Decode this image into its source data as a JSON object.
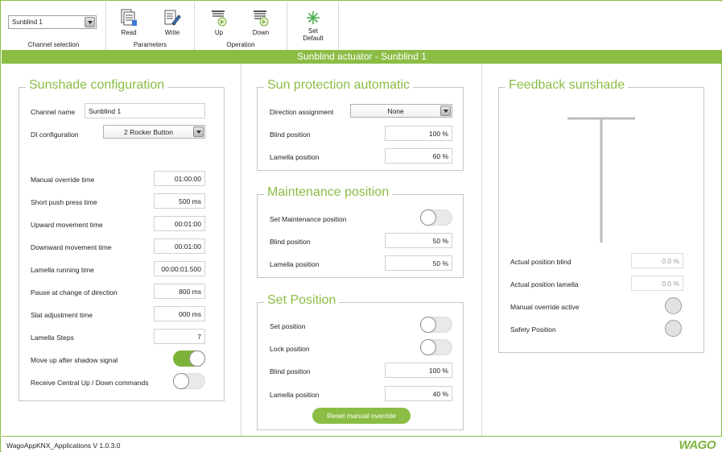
{
  "toolbar": {
    "channel_value": "Sunblind 1",
    "channel_group_label": "Channel selection",
    "read_label": "Read",
    "write_label": "Write",
    "parameters_group_label": "Parameters",
    "up_label": "Up",
    "down_label": "Down",
    "operation_group_label": "Operation",
    "set_default_label_1": "Set",
    "set_default_label_2": "Default"
  },
  "title": "Sunblind actuator - Sunblind 1",
  "sunshade": {
    "legend": "Sunshade configuration",
    "channel_name_label": "Channel name",
    "channel_name_value": "Sunblind 1",
    "di_label": "DI configuration",
    "di_value": "2 Rocker Button",
    "rows": [
      {
        "label": "Manual override time",
        "value": "01:00:00"
      },
      {
        "label": "Short push press time",
        "value": "500 ms"
      },
      {
        "label": "Upward movement time",
        "value": "00:01:00"
      },
      {
        "label": "Downward movement time",
        "value": "00:01:00"
      },
      {
        "label": "Lamella running time",
        "value": "00:00:01.500"
      },
      {
        "label": "Pause at change of direction",
        "value": "800 ms"
      },
      {
        "label": "Slat adjustment time",
        "value": "000 ms"
      },
      {
        "label": "Lamella Steps",
        "value": "7"
      }
    ],
    "move_up_label": "Move up after shadow signal",
    "move_up_on": true,
    "central_label": "Receive Central Up / Down commands",
    "central_on": false
  },
  "sun_protection": {
    "legend": "Sun protection automatic",
    "direction_label": "Direction assignment",
    "direction_value": "None",
    "blind_label": "Blind position",
    "blind_value": "100 %",
    "lamella_label": "Lamella position",
    "lamella_value": "60 %"
  },
  "maintenance": {
    "legend": "Maintenance position",
    "set_label": "Set Maintenance position",
    "set_on": false,
    "blind_label": "Blind position",
    "blind_value": "50 %",
    "lamella_label": "Lamella position",
    "lamella_value": "50 %"
  },
  "set_position": {
    "legend": "Set Position",
    "set_label": "Set position",
    "set_on": false,
    "lock_label": "Lock position",
    "lock_on": false,
    "blind_label": "Blind position",
    "blind_value": "100 %",
    "lamella_label": "Lamella position",
    "lamella_value": "40 %",
    "reset_label": "Reset manual override"
  },
  "feedback": {
    "legend": "Feedback sunshade",
    "actual_blind_label": "Actual position blind",
    "actual_blind_value": "0.0 %",
    "actual_lamella_label": "Actual position lamella",
    "actual_lamella_value": "0.0 %",
    "manual_override_label": "Manual override active",
    "safety_label": "Safety Position"
  },
  "status": {
    "app_version": "WagoAppKNX_Applications V 1.0.3.0",
    "logo": "WAGO"
  },
  "colors": {
    "accent": "#8bbd45",
    "toggle_on": "#7eb33a"
  }
}
